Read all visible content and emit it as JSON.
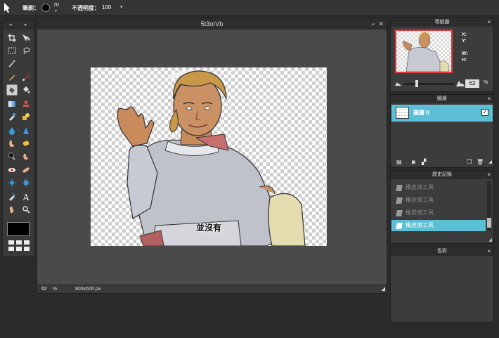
{
  "toolbar": {
    "brush_label": "筆刷：",
    "brush_size": "70",
    "opacity_label": "不透明度：",
    "opacity_value": "100"
  },
  "document": {
    "title": "5t3orVb",
    "caption": "並沒有",
    "zoom": "62",
    "zoom_unit": "%",
    "size": "800x606 px"
  },
  "navigator": {
    "title": "導航器",
    "x_label": "X:",
    "y_label": "Y:",
    "w_label": "W:",
    "h_label": "H:",
    "zoom": "62",
    "zoom_unit": "%"
  },
  "layers": {
    "title": "圖層",
    "items": [
      {
        "name": "圖層 0",
        "visible": true
      }
    ]
  },
  "history": {
    "title": "歷史記錄",
    "items": [
      {
        "label": "橡皮擦工具",
        "active": false
      },
      {
        "label": "橡皮擦工具",
        "active": false
      },
      {
        "label": "橡皮擦工具",
        "active": false
      },
      {
        "label": "橡皮擦工具",
        "active": true
      }
    ]
  },
  "other_panel": {
    "title": "色彩"
  },
  "colors": {
    "accent": "#5bbfd6",
    "nav_border": "#e03a3a"
  },
  "tools": [
    "crop-icon",
    "move-icon",
    "marquee-icon",
    "lasso-icon",
    "magic-wand-icon",
    "pencil-icon",
    "brush-icon",
    "eraser-icon",
    "fill-icon",
    "gradient-icon",
    "stamp-icon",
    "color-replace-icon",
    "drawing-icon",
    "blur-icon",
    "sharpen-icon",
    "smudge-icon",
    "sponge-icon",
    "dodge-icon",
    "burn-icon",
    "red-eye-icon",
    "spot-heal-icon",
    "bloat-icon",
    "pinch-icon",
    "eyedropper-icon",
    "text-icon",
    "hand-icon",
    "zoom-icon"
  ]
}
